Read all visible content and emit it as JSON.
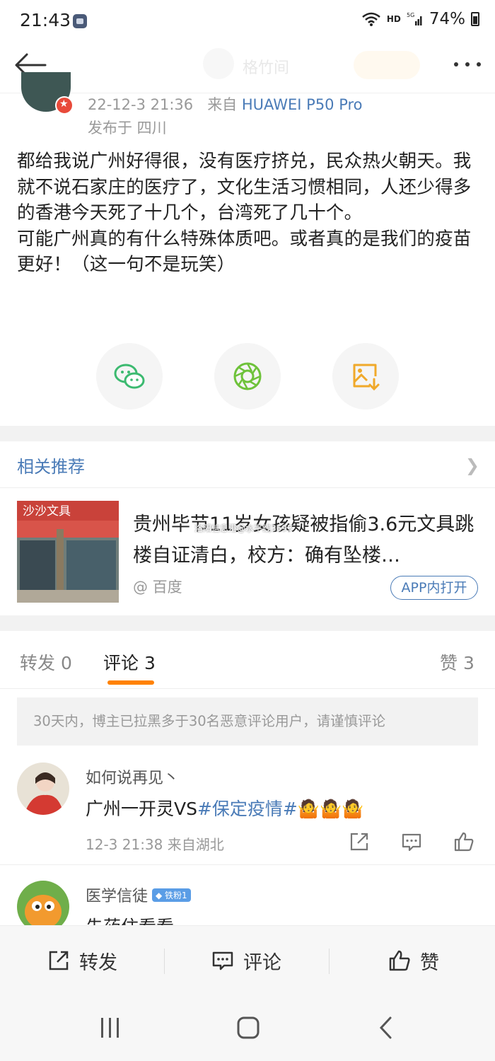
{
  "status_bar": {
    "time": "21:43",
    "hd": "HD",
    "network": "5G",
    "battery": "74%"
  },
  "nav": {
    "username": "格竹间"
  },
  "post": {
    "time": "22-12-3 21:36",
    "from_label": "来自",
    "device": "HUAWEI P50 Pro",
    "location": "发布于 四川",
    "paragraph1": "都给我说广州好得很，没有医疗挤兑，民众热火朝天。我就不说石家庄的医疗了，文化生活习惯相同，人还少得多的香港今天死了十几个，台湾死了几十个。",
    "paragraph2": "可能广州真的有什么特殊体质吧。或者真的是我们的疫苗更好！（这一句不是玩笑）"
  },
  "share": {
    "wechat_icon": "wechat-icon",
    "moments_icon": "moments-icon",
    "save_image_icon": "save-image-icon",
    "wechat_color": "#3cba70",
    "moments_color": "#6ec23a",
    "save_color": "#f0a92a"
  },
  "related": {
    "title": "相关推荐",
    "headline": "贵州毕节11岁女孩疑被指偷3.6元文具跳楼自证清白，校方：确有坠楼…",
    "source": "@ 百度",
    "app_button": "APP内打开",
    "thumb_sign": "沙沙文具"
  },
  "watermark": "洛阳信息港@水平线3693",
  "tabs": {
    "repost": "转发 0",
    "comment": "评论 3",
    "like": "赞 3"
  },
  "notice": "30天内，博主已拉黑多于30名恶意评论用户，请谨慎评论",
  "comments": [
    {
      "name": "如何说再见丶",
      "text_prefix": "广州一开灵VS",
      "tag": "#保定疫情#",
      "emoji": "🤷🤷🤷",
      "meta": "12-3 21:38 来自湖北"
    },
    {
      "name": "医学信徒",
      "badge": "◆ 铁粉1",
      "text": "先药住看看"
    }
  ],
  "action_bar": {
    "repost": "转发",
    "comment": "评论",
    "like": "赞"
  },
  "colors": {
    "accent": "#ff8200",
    "link": "#4a7bb7"
  }
}
